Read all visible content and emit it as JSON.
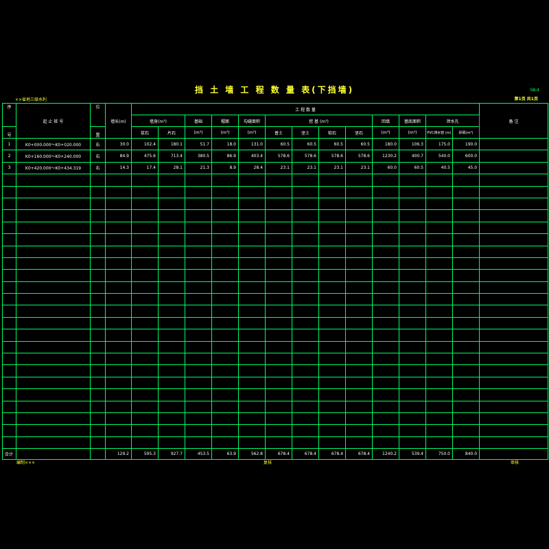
{
  "header": {
    "title": "挡 土 墙 工 程 数 量 表(下挡墙)",
    "sheet_code": "5Ⅲ-4",
    "company": "××省地三级水利",
    "page_info": "第1页  共1页"
  },
  "columns": {
    "seq_top": "序",
    "seq_bottom": "号",
    "station": "起 止 桩 号",
    "pos_top": "位",
    "pos_bottom": "置",
    "length": "墙长(m)",
    "quantities": "工   程   数   量",
    "wall_body": "墙身(m³)",
    "masonry": "浆石",
    "rubble": "片石",
    "foundation": "基础",
    "foundation_unit": "(m³)",
    "cap": "帽面",
    "cap_unit": "(m³)",
    "section": "勾缝面积",
    "section_unit": "(m²)",
    "excavation": "挖  基   (m³)",
    "soil_1": "普土",
    "soil_2": "坚土",
    "soil_3": "软石",
    "soil_4": "坚石",
    "backfill": "回填",
    "backfill_unit": "(m³)",
    "area": "基底面积",
    "area_unit": "(m²)",
    "drain": "泄水孔",
    "drain_a": "PVC排水管 (m)",
    "drain_b": "砂砾(m³)",
    "remark": "备  注"
  },
  "rows": [
    {
      "seq": "1",
      "station": "K0+000.000～K0+020.000",
      "pos": "右",
      "values": [
        "30.0",
        "102.4",
        "180.1",
        "51.7",
        "18.0",
        "131.0",
        "60.5",
        "60.5",
        "60.5",
        "60.5",
        "180.0",
        "106.3",
        "175.0",
        "190.0"
      ]
    },
    {
      "seq": "2",
      "station": "K0+160.000～K0+240.000",
      "pos": "右",
      "values": [
        "84.9",
        "475.6",
        "713.4",
        "380.5",
        "86.9",
        "403.4",
        "578.6",
        "578.6",
        "578.6",
        "578.6",
        "1230.2",
        "400.7",
        "540.0",
        "600.0"
      ]
    },
    {
      "seq": "3",
      "station": "K0+420.000～K0+434.319",
      "pos": "右",
      "values": [
        "14.3",
        "17.4",
        "28.1",
        "21.3",
        "8.9",
        "28.4",
        "23.1",
        "23.1",
        "23.1",
        "23.1",
        "60.0",
        "60.5",
        "40.5",
        "45.0"
      ]
    }
  ],
  "total": {
    "label": "合计",
    "values": [
      "129.2",
      "595.3",
      "927.7",
      "453.5",
      "63.9",
      "562.8",
      "678.4",
      "678.4",
      "678.4",
      "678.4",
      "1240.2",
      "539.4",
      "750.0",
      "840.0"
    ]
  },
  "footer": {
    "designer": "编制×××",
    "checker": "复核",
    "reviewer": "审核"
  }
}
